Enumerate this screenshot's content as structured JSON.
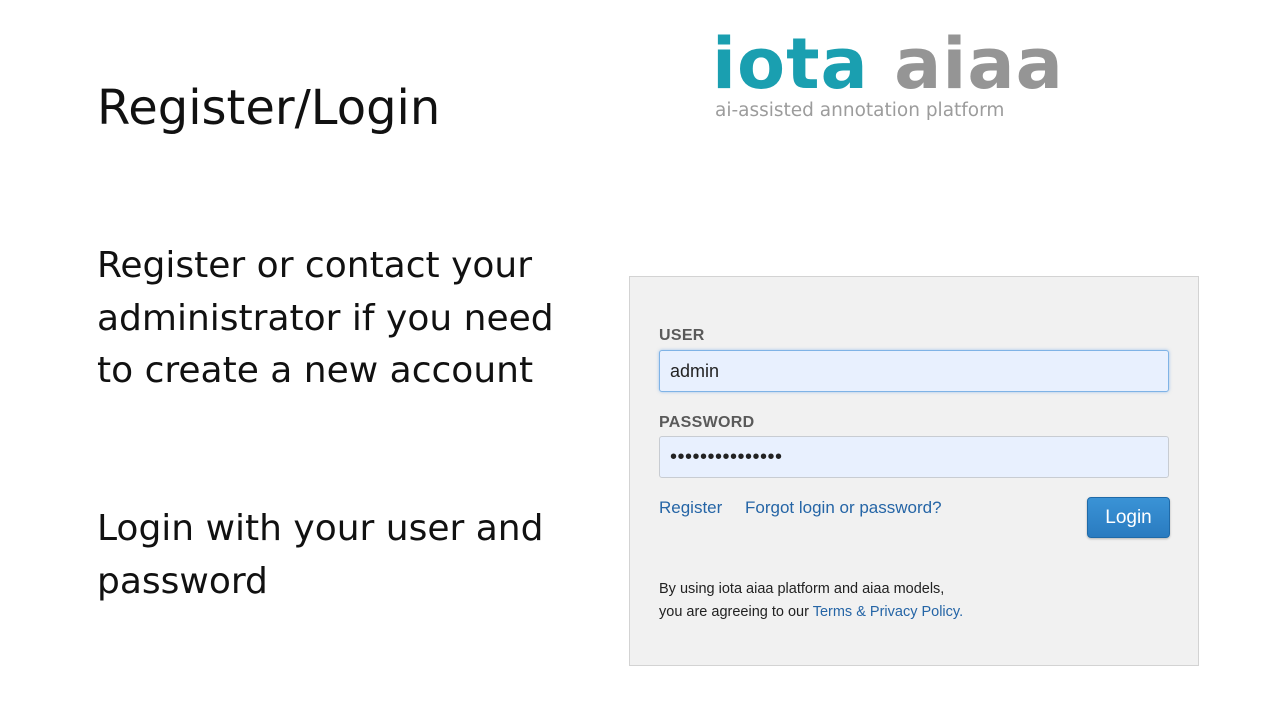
{
  "slide": {
    "title": "Register/Login",
    "paragraph1": "Register or contact your administrator if you need to create a new account",
    "paragraph2": "Login with your user and password"
  },
  "logo": {
    "word1": "iota",
    "word2": "aiaa",
    "tagline": "ai-assisted annotation platform",
    "colors": {
      "word1": "#1a9fb0",
      "word2": "#959595"
    }
  },
  "login_form": {
    "user_label": "USER",
    "user_value": "admin",
    "password_label": "PASSWORD",
    "password_value": "•••••••••••••••",
    "register_link": "Register",
    "forgot_link": "Forgot login or password?",
    "login_button": "Login",
    "terms_line1": "By using iota aiaa platform and aiaa models,",
    "terms_line2_prefix": "you are agreeing to our ",
    "terms_link": "Terms & Privacy Policy.",
    "colors": {
      "link": "#2565a6",
      "button": "#2a7bc0"
    }
  }
}
